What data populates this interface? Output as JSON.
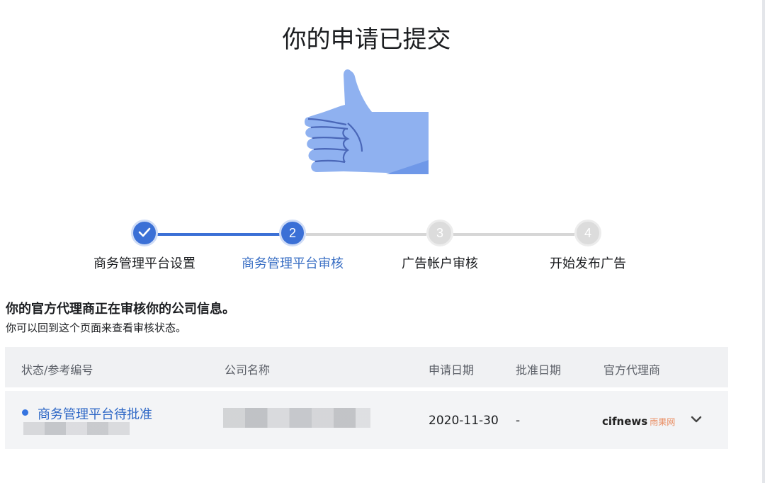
{
  "page": {
    "title": "你的申请已提交",
    "heading": "你的官方代理商正在审核你的公司信息。",
    "subheading": "你可以回到这个页面来查看审核状态。"
  },
  "stepper": {
    "steps": [
      {
        "number": "",
        "label": "商务管理平台设置",
        "state": "done"
      },
      {
        "number": "2",
        "label": "商务管理平台审核",
        "state": "active"
      },
      {
        "number": "3",
        "label": "广告帐户审核",
        "state": "pending"
      },
      {
        "number": "4",
        "label": "开始发布广告",
        "state": "pending"
      }
    ]
  },
  "table": {
    "headers": {
      "status": "状态/参考编号",
      "company": "公司名称",
      "apply_date": "申请日期",
      "approve_date": "批准日期",
      "agent": "官方代理商"
    },
    "rows": [
      {
        "status": "商务管理平台待批准",
        "apply_date": "2020-11-30",
        "approve_date": "-",
        "agent_logo_main": "cifnews",
        "agent_logo_cn": "雨果网"
      }
    ]
  },
  "colors": {
    "accent": "#3b70d6",
    "pending": "#dcdcdc",
    "thumb": "#8fb1f0"
  },
  "icons": [
    "thumbs-up-icon",
    "check-icon",
    "chevron-down-icon"
  ]
}
